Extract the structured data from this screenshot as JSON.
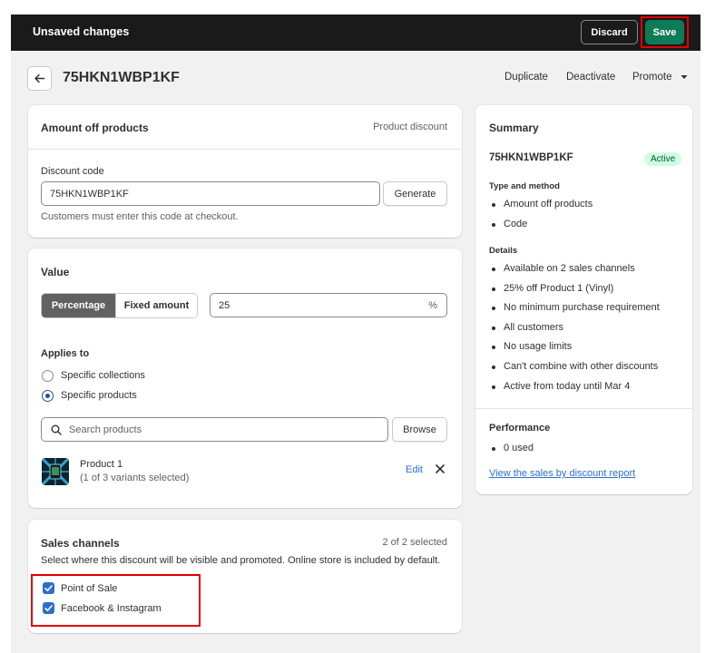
{
  "topbar": {
    "title": "Unsaved changes",
    "discard_label": "Discard",
    "save_label": "Save"
  },
  "header": {
    "title": "75HKN1WBP1KF",
    "actions": {
      "duplicate": "Duplicate",
      "deactivate": "Deactivate",
      "promote": "Promote"
    }
  },
  "amount_card": {
    "title": "Amount off products",
    "type_label": "Product discount",
    "code_label": "Discount code",
    "code_value": "75HKN1WBP1KF",
    "generate_label": "Generate",
    "help_text": "Customers must enter this code at checkout."
  },
  "value_card": {
    "title": "Value",
    "percentage_label": "Percentage",
    "fixed_label": "Fixed amount",
    "value": "25",
    "suffix": "%",
    "applies_to_label": "Applies to",
    "options": [
      "Specific collections",
      "Specific products"
    ],
    "selected_option": "Specific products",
    "search_placeholder": "Search products",
    "browse_label": "Browse",
    "product": {
      "name": "Product 1",
      "variants": "(1 of 3 variants selected)",
      "edit_label": "Edit"
    }
  },
  "sales_card": {
    "title": "Sales channels",
    "selected_count": "2 of 2 selected",
    "description": "Select where this discount will be visible and promoted. Online store is included by default.",
    "channels": [
      "Point of Sale",
      "Facebook & Instagram"
    ]
  },
  "summary": {
    "title": "Summary",
    "code": "75HKN1WBP1KF",
    "status": "Active",
    "type_heading": "Type and method",
    "type_items": [
      "Amount off products",
      "Code"
    ],
    "details_heading": "Details",
    "details_items": [
      "Available on 2 sales channels",
      "25% off Product 1 (Vinyl)",
      "No minimum purchase requirement",
      "All customers",
      "No usage limits",
      "Can't combine with other discounts",
      "Active from today until Mar 4"
    ],
    "performance_heading": "Performance",
    "performance_items": [
      "0 used"
    ],
    "report_link": "View the sales by discount report"
  },
  "colors": {
    "topbar": "#1a1a1a",
    "save": "#0f7a56",
    "highlight": "#e00000",
    "link": "#2c6ecb",
    "badge_bg": "#cdfee1"
  }
}
